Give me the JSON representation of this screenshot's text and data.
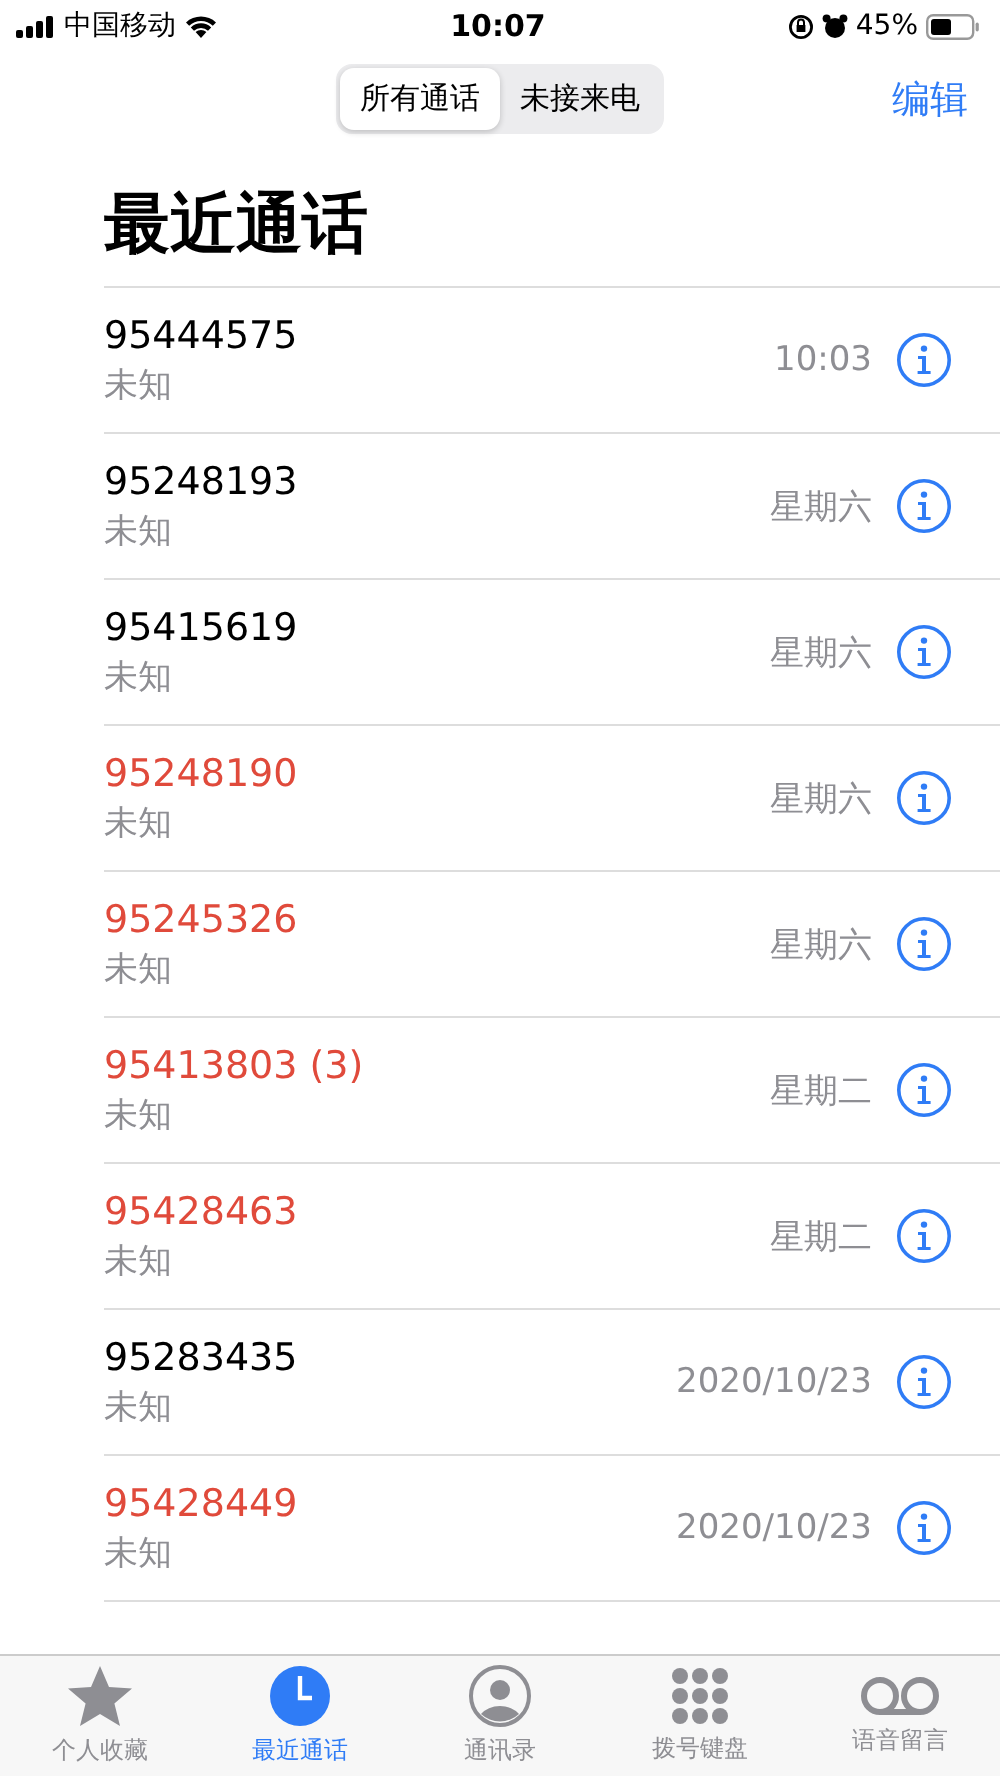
{
  "status_bar": {
    "carrier": "中国移动",
    "time": "10:07",
    "battery": "45%"
  },
  "segments": [
    {
      "label": "所有通话",
      "selected": true
    },
    {
      "label": "未接来电",
      "selected": false
    }
  ],
  "edit": "编辑",
  "title": "最近通话",
  "calls": [
    {
      "number": "95444575",
      "label": "未知",
      "time": "10:03",
      "missed": false
    },
    {
      "number": "95248193",
      "label": "未知",
      "time": "星期六",
      "missed": false
    },
    {
      "number": "95415619",
      "label": "未知",
      "time": "星期六",
      "missed": false
    },
    {
      "number": "95248190",
      "label": "未知",
      "time": "星期六",
      "missed": true
    },
    {
      "number": "95245326",
      "label": "未知",
      "time": "星期六",
      "missed": true
    },
    {
      "number": "95413803 (3)",
      "label": "未知",
      "time": "星期二",
      "missed": true
    },
    {
      "number": "95428463",
      "label": "未知",
      "time": "星期二",
      "missed": true
    },
    {
      "number": "95283435",
      "label": "未知",
      "time": "2020/10/23",
      "missed": false
    },
    {
      "number": "95428449",
      "label": "未知",
      "time": "2020/10/23",
      "missed": true
    }
  ],
  "tabs": [
    {
      "kind": "star",
      "label": "个人收藏",
      "selected": false
    },
    {
      "kind": "clock",
      "label": "最近通话",
      "selected": true
    },
    {
      "kind": "person",
      "label": "通讯录",
      "selected": false
    },
    {
      "kind": "keypad",
      "label": "拨号键盘",
      "selected": false
    },
    {
      "kind": "voicemail",
      "label": "语音留言",
      "selected": false
    }
  ]
}
